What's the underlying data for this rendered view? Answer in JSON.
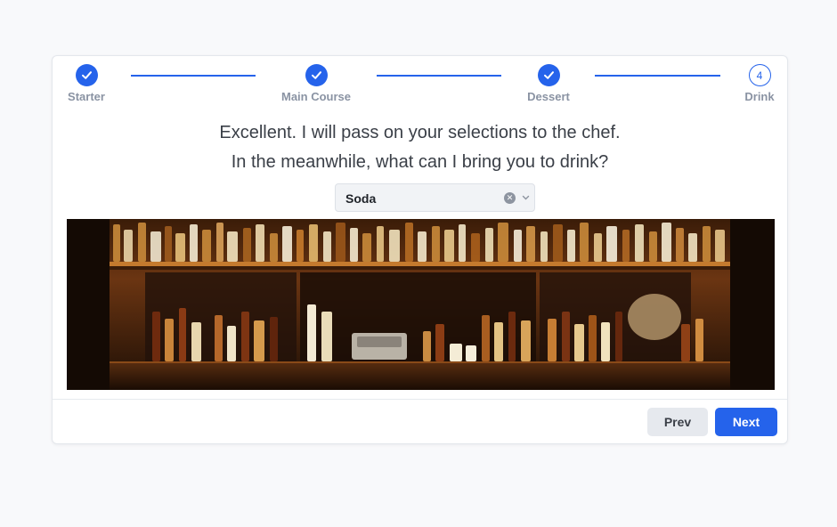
{
  "steps": [
    {
      "label": "Starter",
      "state": "complete",
      "icon": "check-icon"
    },
    {
      "label": "Main Course",
      "state": "complete",
      "icon": "check-icon"
    },
    {
      "label": "Dessert",
      "state": "complete",
      "icon": "check-icon"
    },
    {
      "label": "Drink",
      "state": "current",
      "number": "4"
    }
  ],
  "message": {
    "line1": "Excellent. I will pass on your selections to the chef.",
    "line2": "In the meanwhile, what can I bring you to drink?"
  },
  "drink_select": {
    "value": "Soda",
    "clear_icon": "clear-icon",
    "dropdown_icon": "chevron-down-icon"
  },
  "image": {
    "subject": "bar-shelves-photo"
  },
  "buttons": {
    "prev": "Prev",
    "next": "Next"
  },
  "colors": {
    "accent": "#2563eb",
    "step_label": "#8a93a3",
    "text": "#3a3f47"
  }
}
